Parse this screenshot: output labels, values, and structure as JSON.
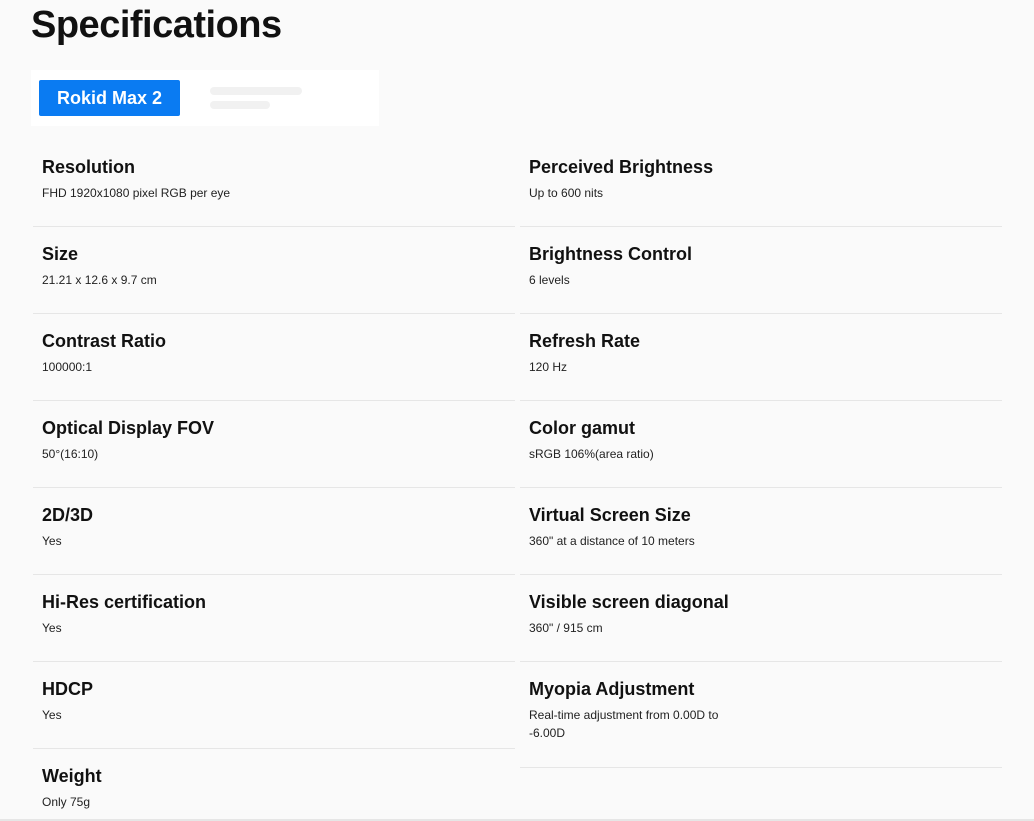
{
  "page_title": "Specifications",
  "tabs": [
    {
      "label": "Rokid Max 2",
      "active": true
    }
  ],
  "accent_color": "#0a7bf2",
  "specs_left": [
    {
      "label": "Resolution",
      "value": "FHD 1920x1080 pixel RGB per eye"
    },
    {
      "label": "Size",
      "value": "21.21 x 12.6 x 9.7 cm"
    },
    {
      "label": "Contrast Ratio",
      "value": "100000:1"
    },
    {
      "label": "Optical Display FOV",
      "value": "50°(16:10)"
    },
    {
      "label": "2D/3D",
      "value": "Yes"
    },
    {
      "label": "Hi-Res certification",
      "value": "Yes"
    },
    {
      "label": "HDCP",
      "value": "Yes"
    },
    {
      "label": "Weight",
      "value": "Only 75g"
    }
  ],
  "specs_right": [
    {
      "label": "Perceived Brightness",
      "value": "Up to 600 nits"
    },
    {
      "label": "Brightness Control",
      "value": "6 levels"
    },
    {
      "label": "Refresh Rate",
      "value": "120 Hz"
    },
    {
      "label": "Color gamut",
      "value": "sRGB 106%(area ratio)"
    },
    {
      "label": "Virtual Screen Size",
      "value": "360\" at a distance of 10 meters"
    },
    {
      "label": "Visible screen diagonal",
      "value": "360\" / 915 cm"
    },
    {
      "label": "Myopia Adjustment",
      "value": "Real-time adjustment from 0.00D to -6.00D"
    }
  ]
}
